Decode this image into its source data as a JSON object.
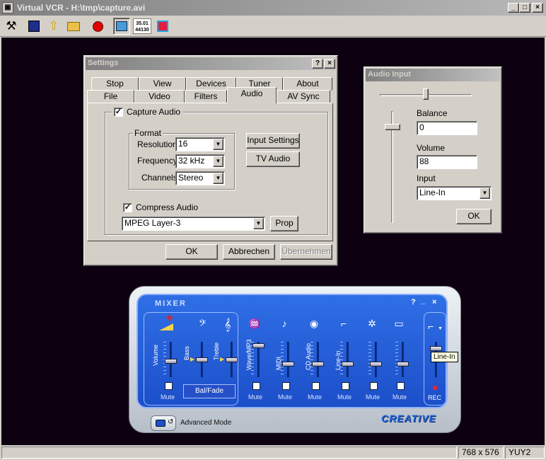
{
  "window": {
    "title": "Virtual VCR - H:\\tmp\\capture.avi",
    "minimize": "_",
    "maximize": "□",
    "close": "×"
  },
  "toolbar": {
    "info_line1": "35.01",
    "info_line2": "44130"
  },
  "settings": {
    "title": "Settings",
    "help": "?",
    "close": "×",
    "tabs_row1": [
      "Stop",
      "View",
      "Devices",
      "Tuner",
      "About"
    ],
    "tabs_row2": [
      "File",
      "Video",
      "Filters",
      "Audio",
      "AV Sync"
    ],
    "capture_audio": "Capture Audio",
    "format_group": "Format",
    "resolution_label": "Resolution",
    "resolution_value": "16",
    "frequency_label": "Frequency",
    "frequency_value": "32 kHz",
    "channels_label": "Channels",
    "channels_value": "Stereo",
    "input_settings": "Input Settings",
    "tv_audio": "TV Audio",
    "compress_audio": "Compress Audio",
    "codec_value": "MPEG Layer-3",
    "prop": "Prop",
    "ok": "OK",
    "cancel": "Abbrechen",
    "apply": "Übernehmen",
    "check_mark": "✓"
  },
  "audio_input": {
    "title": "Audio Input",
    "balance_label": "Balance",
    "balance_value": "0",
    "volume_label": "Volume",
    "volume_value": "88",
    "input_label": "Input",
    "input_value": "Line-In",
    "ok": "OK"
  },
  "mixer": {
    "title": "MIXER",
    "help": "?",
    "minimize": "_",
    "close": "×",
    "volume": "Volume",
    "bass": "Bass",
    "treble": "Treble",
    "mute": "Mute",
    "bal_fade": "Bal/Fade",
    "channels": [
      {
        "label": "Wave/MP3",
        "mute": "Mute"
      },
      {
        "label": "MIDI",
        "mute": "Mute"
      },
      {
        "label": "CD Audio",
        "mute": "Mute"
      },
      {
        "label": "Line-In",
        "mute": "Mute"
      },
      {
        "label": "",
        "mute": "Mute"
      },
      {
        "label": "",
        "mute": "Mute"
      }
    ],
    "rec": "REC",
    "tooltip": "Line-In",
    "advanced": "Advanced Mode",
    "brand": "CREATIVE"
  },
  "status": {
    "resolution": "768 x 576",
    "format": "YUY2"
  }
}
